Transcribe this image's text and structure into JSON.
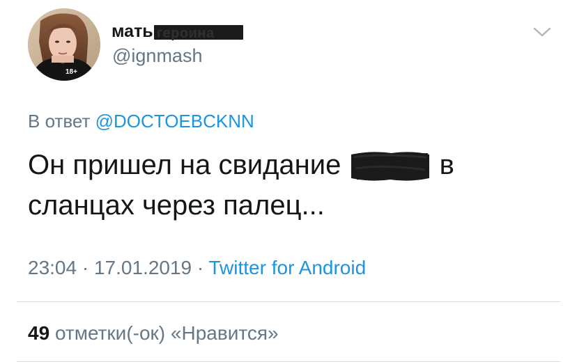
{
  "tweet": {
    "author": {
      "display_name": "мать",
      "display_name_obscured": "героина",
      "handle": "@ignmash",
      "avatar_badge": "18+"
    },
    "reply_to": {
      "prefix": "В ответ",
      "mention": "@DOCTOEBCKNN"
    },
    "text_before_redaction": "Он пришел на свидание",
    "text_after_redaction": "в сланцах через палец...",
    "time": "23:04",
    "date": "17.01.2019",
    "separator": "·",
    "source": "Twitter for Android",
    "likes_count": "49",
    "likes_label": "отметки(-ок) «Нравится»"
  },
  "icons": {
    "menu": "chevron-down-icon"
  },
  "colors": {
    "text_primary": "#14171a",
    "text_secondary": "#657786",
    "link": "#1b95e0",
    "divider": "#d6dde2"
  }
}
